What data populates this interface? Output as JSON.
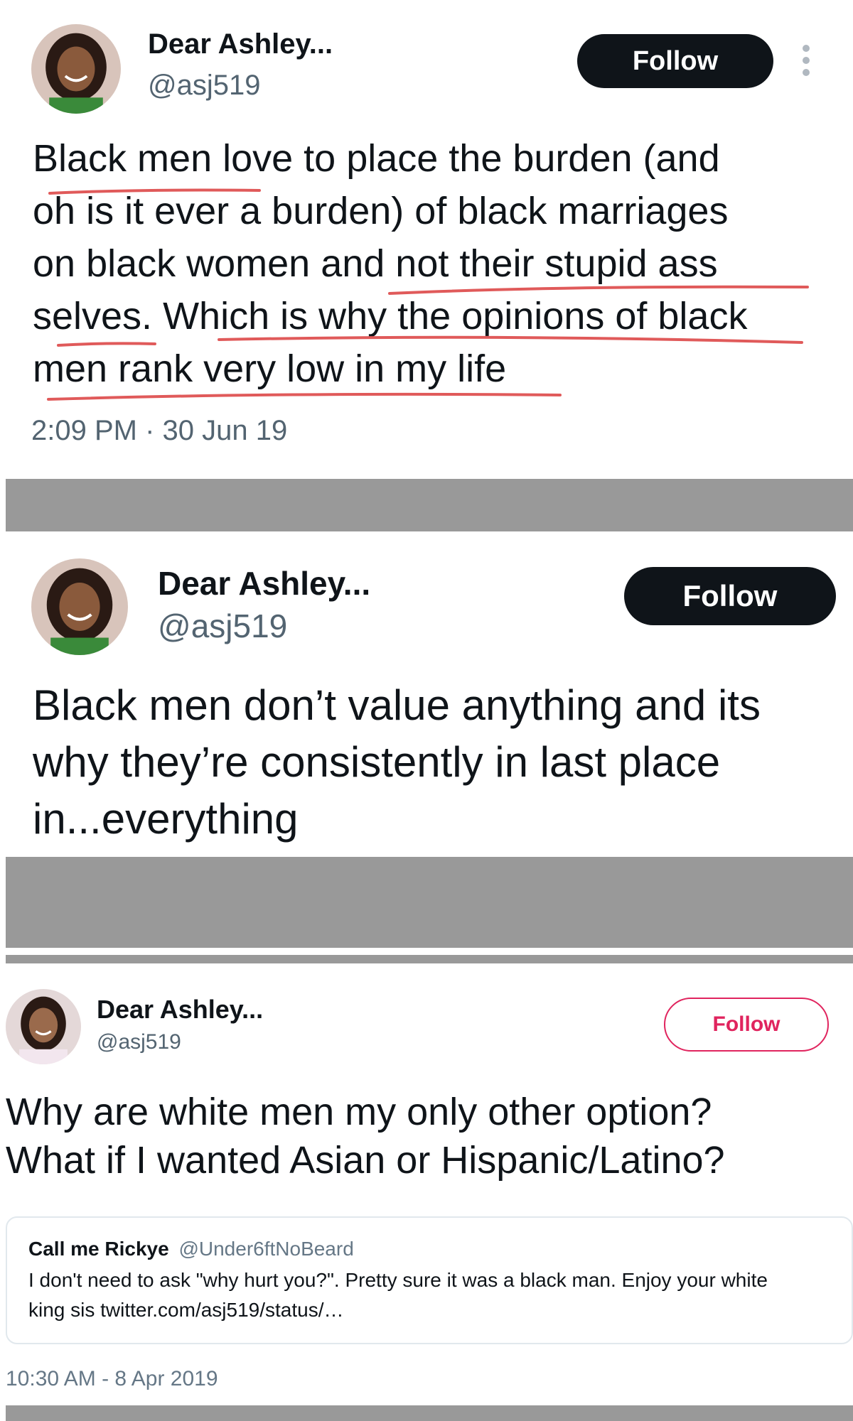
{
  "tweet1": {
    "name": "Dear Ashley...",
    "handle": "@asj519",
    "follow_label": "Follow",
    "more_icon": "vertical-ellipsis-icon",
    "lines": [
      "Black men love to place the burden (and",
      "oh is it ever a burden) of black marriages",
      "on black women and not their stupid ass",
      "selves. Which is why the opinions of black",
      "men rank very low in my life"
    ],
    "timestamp": "2:09 PM · 30 Jun 19",
    "underline_color": "#e05a5a"
  },
  "tweet2": {
    "name": "Dear Ashley...",
    "handle": "@asj519",
    "follow_label": "Follow",
    "lines": [
      "Black men don’t value anything and its",
      "why they’re consistently in last place",
      "in...everything"
    ]
  },
  "tweet3": {
    "name": "Dear Ashley...",
    "handle": "@asj519",
    "follow_label": "Follow",
    "lines": [
      "Why are white men my only other option?",
      "What if I wanted Asian or Hispanic/Latino?"
    ],
    "quote": {
      "name": "Call me Rickye",
      "handle": "@Under6ftNoBeard",
      "lines": [
        "I don't need to ask \"why hurt you?\". Pretty sure it was a black man. Enjoy your white",
        "king sis twitter.com/asj519/status/…"
      ]
    },
    "timestamp": "10:30 AM - 8 Apr 2019"
  },
  "colors": {
    "divider_gray": "#999999",
    "follow_dark": "#0f1419",
    "follow_outline": "#e0245e"
  }
}
